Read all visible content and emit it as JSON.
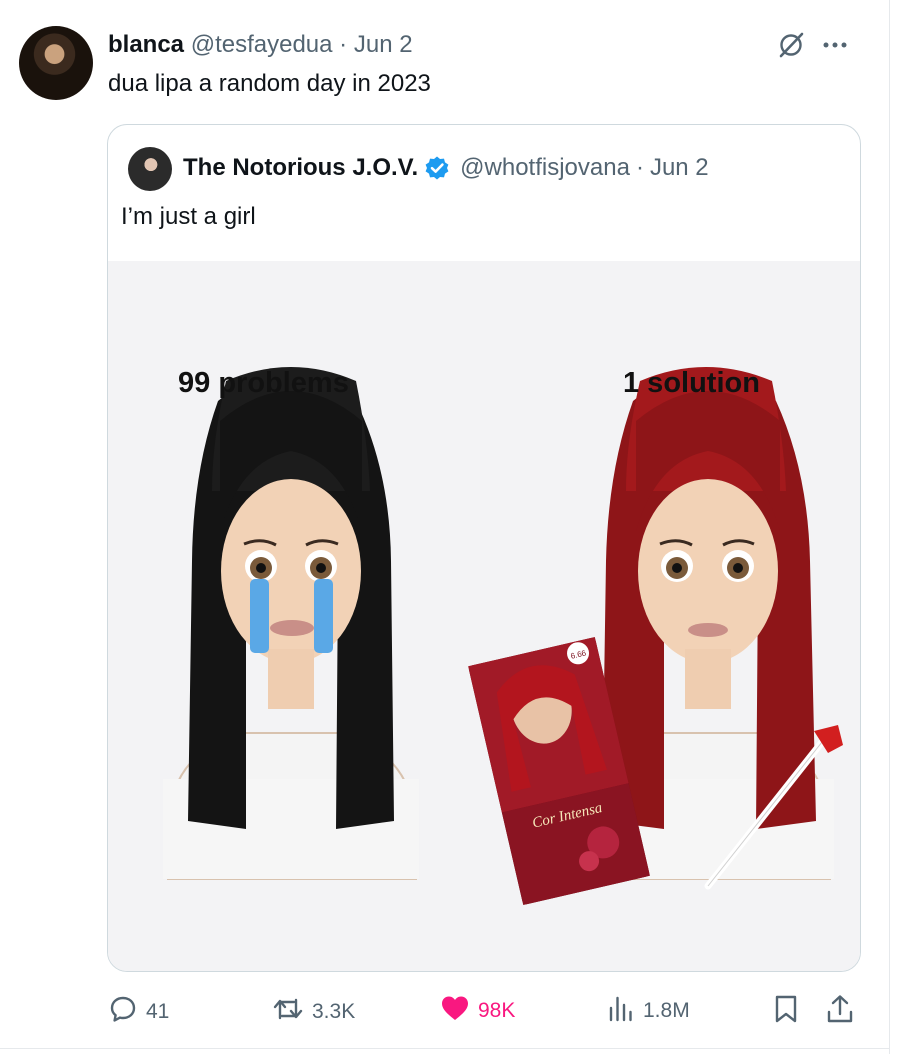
{
  "tweet": {
    "author_name": "blanca",
    "handle": "@tesfayedua",
    "separator": "·",
    "date": "Jun 2",
    "text": "dua lipa a random day in 2023"
  },
  "quote": {
    "author_name": "The Notorious J.O.V.",
    "handle": "@whotfisjovana",
    "separator": "·",
    "date": "Jun 2",
    "text": "I’m just a girl",
    "image": {
      "left_caption": "99 problems",
      "right_caption": "1 solution",
      "box_brand": "Cor Intensa",
      "box_shade": "6.66"
    }
  },
  "actions": {
    "replies": "41",
    "reposts": "3.3K",
    "likes": "98K",
    "views": "1.8M"
  },
  "colors": {
    "text": "#0f1419",
    "muted": "#536471",
    "verified": "#1d9bf0",
    "like": "#f91880",
    "border": "#cfd9de"
  },
  "icons": {
    "grok": "grok-icon",
    "more": "more-icon",
    "verified": "verified-badge-icon",
    "reply": "reply-icon",
    "repost": "repost-icon",
    "like": "heart-icon",
    "views": "views-icon",
    "bookmark": "bookmark-icon",
    "share": "share-icon"
  }
}
